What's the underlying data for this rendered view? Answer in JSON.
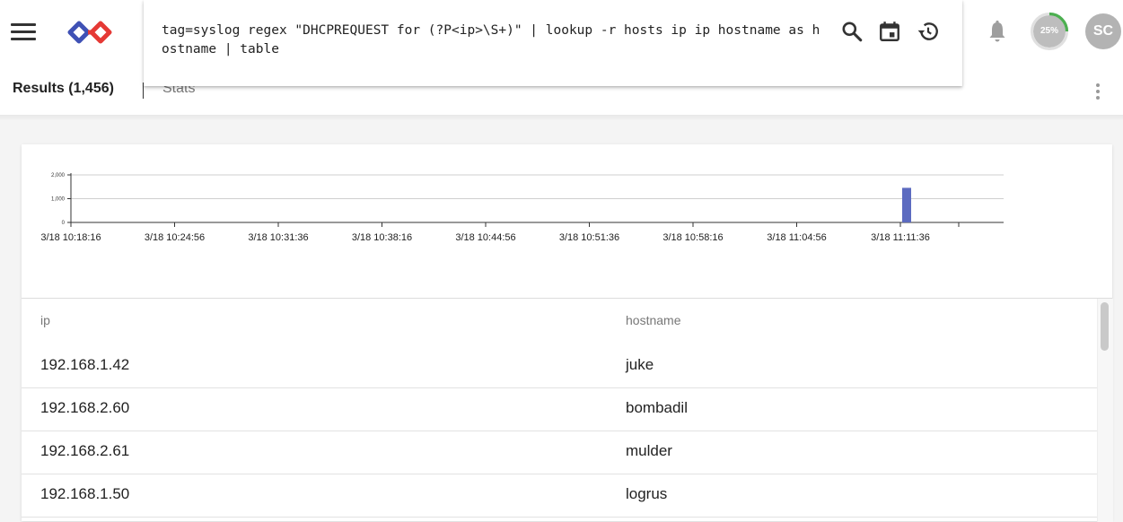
{
  "header": {
    "query": "tag=syslog regex \"DHCPREQUEST for (?P<ip>\\S+)\" | lookup -r hosts ip ip hostname as hostname | table",
    "progress": 0.25,
    "progress_label": "25%",
    "avatar_initials": "SC",
    "icons": [
      "menu-icon",
      "logo-icon",
      "search-icon",
      "calendar-icon",
      "history-icon",
      "bell-icon"
    ]
  },
  "tabs": {
    "results_label": "Results (1,456)",
    "stats_label": "Stats"
  },
  "colors": {
    "bar": "#5c6bc0",
    "progress_ring": "#4caf50",
    "logo_red": "#e53935",
    "logo_blue": "#3f51b5"
  },
  "chart_data": {
    "type": "bar",
    "title": "",
    "xlabel": "",
    "ylabel": "",
    "ylim": [
      0,
      2000
    ],
    "y_ticks": [
      "0",
      "1,000",
      "2,000"
    ],
    "y_tick_values": [
      0,
      1000,
      2000
    ],
    "x_ticks": [
      "3/18 10:18:16",
      "3/18 10:24:56",
      "3/18 10:31:36",
      "3/18 10:38:16",
      "3/18 10:44:56",
      "3/18 10:51:36",
      "3/18 10:58:16",
      "3/18 11:04:56",
      "3/18 11:11:36"
    ],
    "bars": [
      {
        "x": "3/18 11:11:36",
        "value": 1456
      }
    ],
    "grid": true
  },
  "table": {
    "columns": [
      "ip",
      "hostname"
    ],
    "rows": [
      [
        "192.168.1.42",
        "juke"
      ],
      [
        "192.168.2.60",
        "bombadil"
      ],
      [
        "192.168.2.61",
        "mulder"
      ],
      [
        "192.168.1.50",
        "logrus"
      ]
    ]
  }
}
